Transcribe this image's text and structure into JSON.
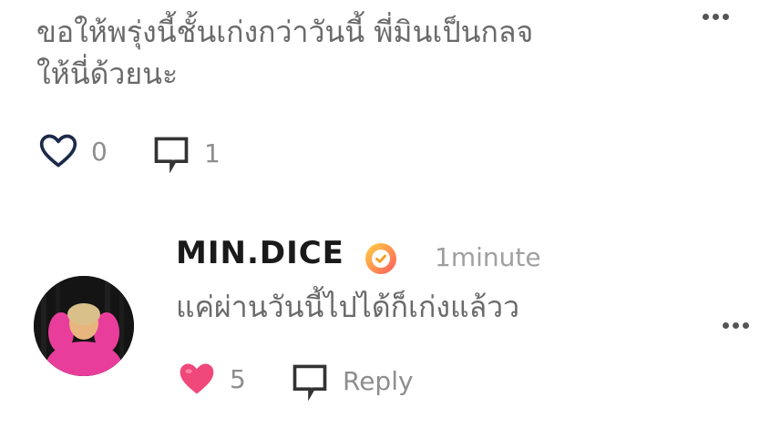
{
  "parent_comment": {
    "text_line1": "ขอให้พรุ่งนี้ชั้นเก่งกว่าวันนี้ พี่มินเป็นกลจ",
    "text_line2": "ให้นี่ด้วยนะ",
    "likes": "0",
    "comments": "1",
    "icons": {
      "like": "heart-outline-icon",
      "comment": "comment-icon",
      "more": "more-dots-icon"
    }
  },
  "reply_comment": {
    "username": "MIN.DICE",
    "time": "1minute",
    "text": "แค่ผ่านวันนี้ไปได้ก็เก่งแล้วว",
    "likes": "5",
    "reply_label": "Reply",
    "verified": true,
    "icons": {
      "like": "heart-filled-icon",
      "reply": "comment-icon",
      "more": "more-dots-icon",
      "verified": "verified-badge-icon"
    }
  },
  "colors": {
    "heart_filled": "#f0487a",
    "heart_outline": "#1c2a4a",
    "badge_gradient_start": "#ffd23f",
    "badge_gradient_end": "#ff5a5f",
    "text_muted": "#8e8e8e"
  }
}
